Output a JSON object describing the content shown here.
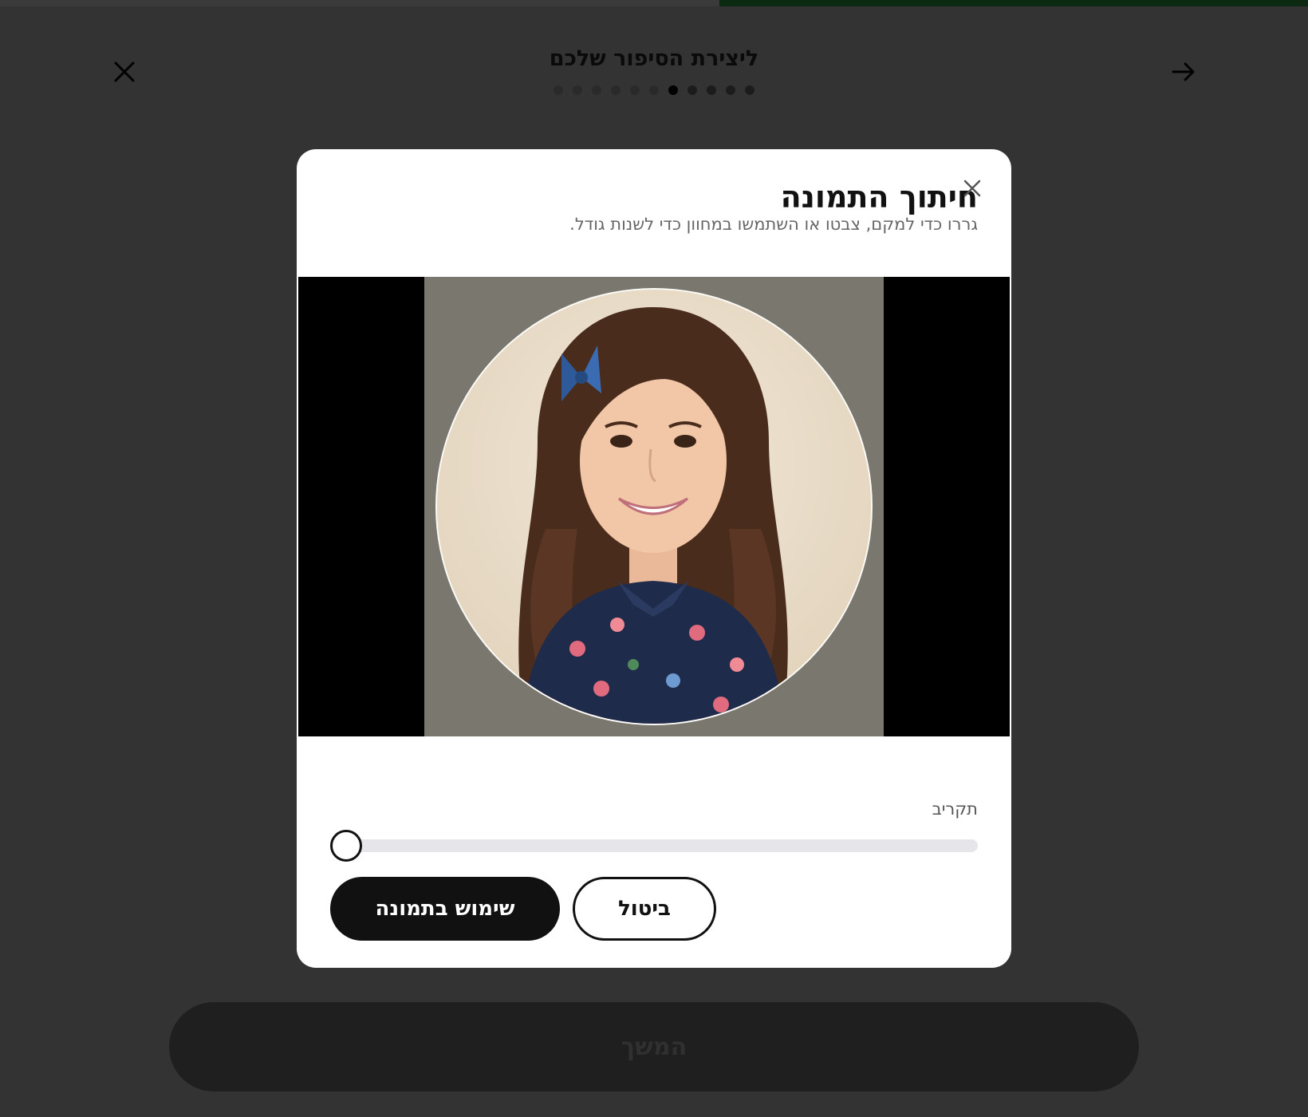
{
  "header": {
    "title": "ליצירת הסיפור שלכם",
    "close_icon": "close-icon",
    "back_icon": "arrow-right-icon",
    "progress_fraction": 0.45,
    "steps_total": 11,
    "current_step": 7
  },
  "modal": {
    "title": "חיתוך התמונה",
    "subtitle": "גררו כדי למקם, צבטו או השתמשו במחוון כדי לשנות גודל.",
    "close_icon": "close-icon",
    "zoom_label": "תקריב",
    "zoom_value": 0,
    "use_button": "שימוש בתמונה",
    "cancel_button": "ביטול"
  },
  "footer": {
    "continue_button": "המשך"
  },
  "colors": {
    "progress": "#0c2a12",
    "backdrop": "#333333",
    "primary_button": "#111111"
  }
}
